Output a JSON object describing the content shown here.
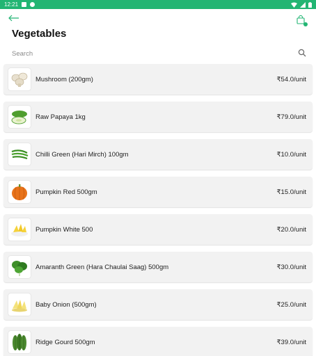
{
  "status": {
    "time": "12:21"
  },
  "header": {
    "title": "Vegetables"
  },
  "search": {
    "placeholder": "Search"
  },
  "products": [
    {
      "name": "Mushroom (200gm)",
      "price": "₹54.0/unit",
      "icon": "mushroom-icon"
    },
    {
      "name": "Raw Papaya 1kg",
      "price": "₹79.0/unit",
      "icon": "papaya-icon"
    },
    {
      "name": "Chilli Green (Hari Mirch) 100gm",
      "price": "₹10.0/unit",
      "icon": "chilli-icon"
    },
    {
      "name": "Pumpkin Red 500gm",
      "price": "₹15.0/unit",
      "icon": "pumpkin-icon"
    },
    {
      "name": "Pumpkin White 500",
      "price": "₹20.0/unit",
      "icon": "pumpkin-white-icon"
    },
    {
      "name": "Amaranth Green (Hara Chaulai Saag) 500gm",
      "price": "₹30.0/unit",
      "icon": "amaranth-icon"
    },
    {
      "name": "Baby Onion (500gm)",
      "price": "₹25.0/unit",
      "icon": "baby-onion-icon"
    },
    {
      "name": "Ridge Gourd 500gm",
      "price": "₹39.0/unit",
      "icon": "ridge-gourd-icon"
    }
  ],
  "colors": {
    "accent": "#22b573",
    "card": "#f2f2f2"
  }
}
